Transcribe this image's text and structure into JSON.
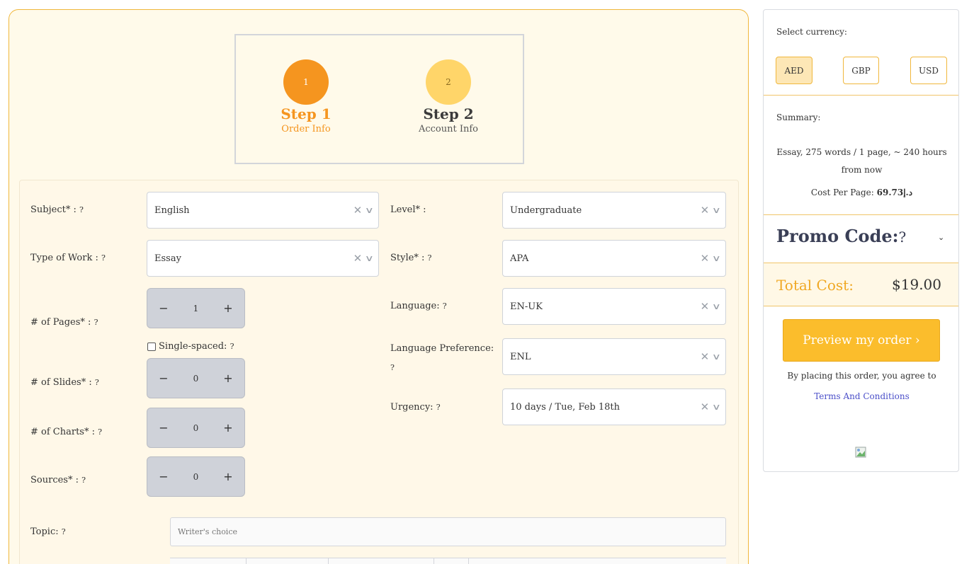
{
  "steps": [
    {
      "number": "1",
      "title": "Step 1",
      "subtitle": "Order Info"
    },
    {
      "number": "2",
      "title": "Step 2",
      "subtitle": "Account Info"
    }
  ],
  "form": {
    "subject": {
      "label": "Subject* :",
      "value": "English"
    },
    "type_of_work": {
      "label": "Type of Work :",
      "value": "Essay"
    },
    "pages": {
      "label": "# of Pages* :",
      "value": "1"
    },
    "single_spaced": {
      "label": "Single-spaced:",
      "checked": false
    },
    "slides": {
      "label": "# of Slides* :",
      "value": "0"
    },
    "charts": {
      "label": "# of Charts* :",
      "value": "0"
    },
    "sources": {
      "label": "Sources* :",
      "value": "0"
    },
    "level": {
      "label": "Level* :",
      "value": "Undergraduate"
    },
    "style": {
      "label": "Style* :",
      "value": "APA"
    },
    "language": {
      "label": "Language:",
      "value": "EN-UK"
    },
    "language_pref": {
      "label": "Language Preference:",
      "value": "ENL"
    },
    "urgency": {
      "label": "Urgency:",
      "value": "10 days / Tue, Feb 18th"
    },
    "topic": {
      "label": "Topic:",
      "placeholder": "Writer's choice"
    },
    "help_icon": "?",
    "clear_icon": "✕",
    "chevron_icon": "∨",
    "minus": "−",
    "plus": "+"
  },
  "sidebar": {
    "currency_label": "Select currency:",
    "currencies": [
      {
        "code": "AED",
        "active": true
      },
      {
        "code": "GBP",
        "active": false
      },
      {
        "code": "USD",
        "active": false
      }
    ],
    "summary_label": "Summary:",
    "summary_line": "Essay, 275 words / 1 page, ~ 240 hours from now",
    "cost_per_page_label": "Cost Per Page:",
    "cost_per_page_value": "د.إ69.73",
    "promo_label": "Promo Code:",
    "promo_chevron": "⌄",
    "total_label": "Total Cost:",
    "total_value": "$19.00",
    "preview_button": "Preview my order ›",
    "agree_text": "By placing this order, you agree to",
    "terms_link": "Terms And Conditions"
  },
  "colors": {
    "accent": "#f5951f",
    "accent_light": "#ffd569",
    "button": "#fbbd2c",
    "link": "#4b4fc9",
    "panel_bg": "#fff8e8"
  }
}
